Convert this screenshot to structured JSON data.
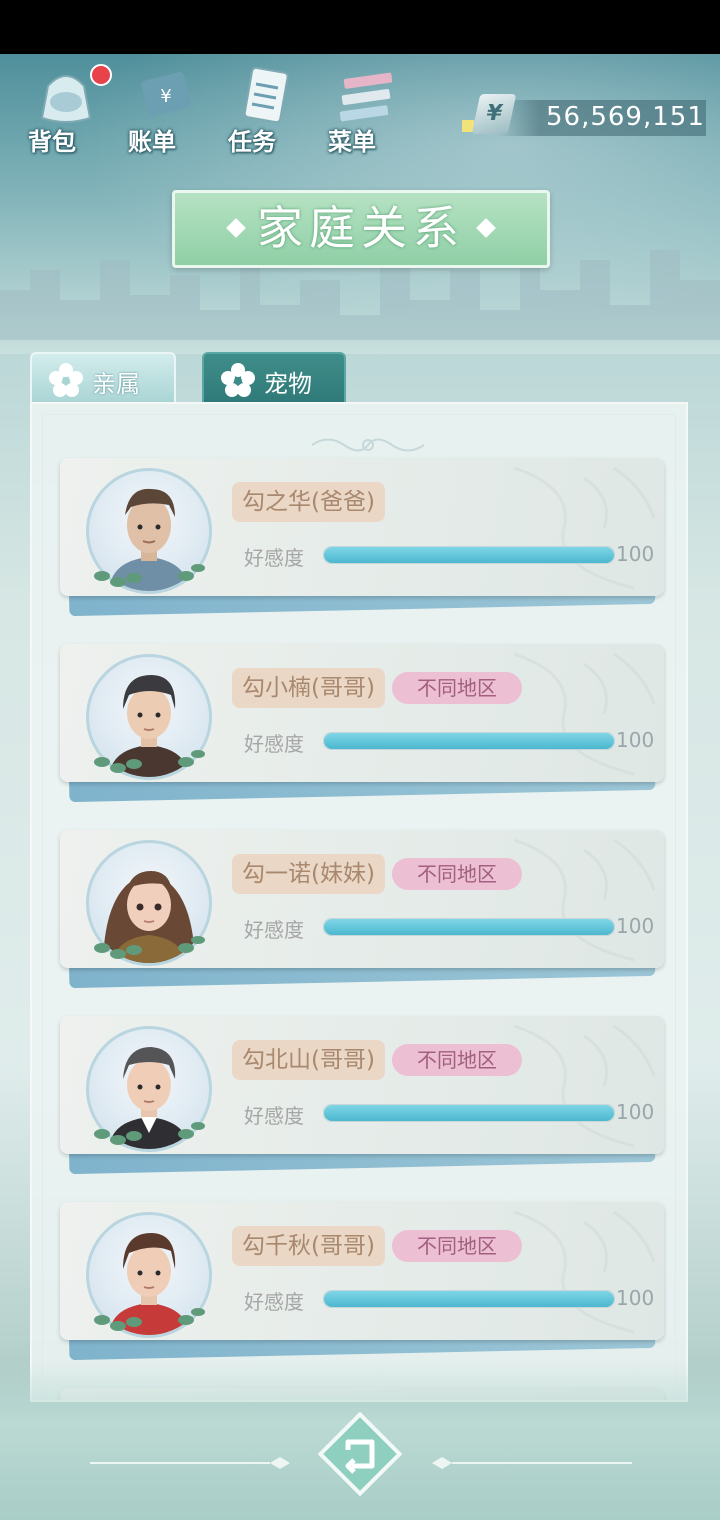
{
  "nav": {
    "items": [
      {
        "label": "背包",
        "icon": "bag-icon",
        "has_notification": true
      },
      {
        "label": "账单",
        "icon": "bill-icon",
        "has_notification": false
      },
      {
        "label": "任务",
        "icon": "task-icon",
        "has_notification": false
      },
      {
        "label": "菜单",
        "icon": "menu-icon",
        "has_notification": false
      }
    ]
  },
  "currency": {
    "symbol": "¥",
    "amount": "56,569,151"
  },
  "title": "家庭关系",
  "tabs": [
    {
      "label": "亲属",
      "active": true
    },
    {
      "label": "宠物",
      "active": false
    }
  ],
  "affection_label": "好感度",
  "relatives": [
    {
      "name": "勾之华(爸爸)",
      "region": "",
      "affection": 100,
      "affection_text": "100"
    },
    {
      "name": "勾小楠(哥哥)",
      "region": "不同地区",
      "affection": 100,
      "affection_text": "100"
    },
    {
      "name": "勾一诺(妹妹)",
      "region": "不同地区",
      "affection": 100,
      "affection_text": "100"
    },
    {
      "name": "勾北山(哥哥)",
      "region": "不同地区",
      "affection": 100,
      "affection_text": "100"
    },
    {
      "name": "勾千秋(哥哥)",
      "region": "不同地区",
      "affection": 100,
      "affection_text": "100"
    }
  ],
  "colors": {
    "accent_green": "#8fcfa6",
    "bar_blue": "#4cb7cf",
    "region_pink": "#ecbfd3",
    "name_beige": "#ead7c6"
  }
}
